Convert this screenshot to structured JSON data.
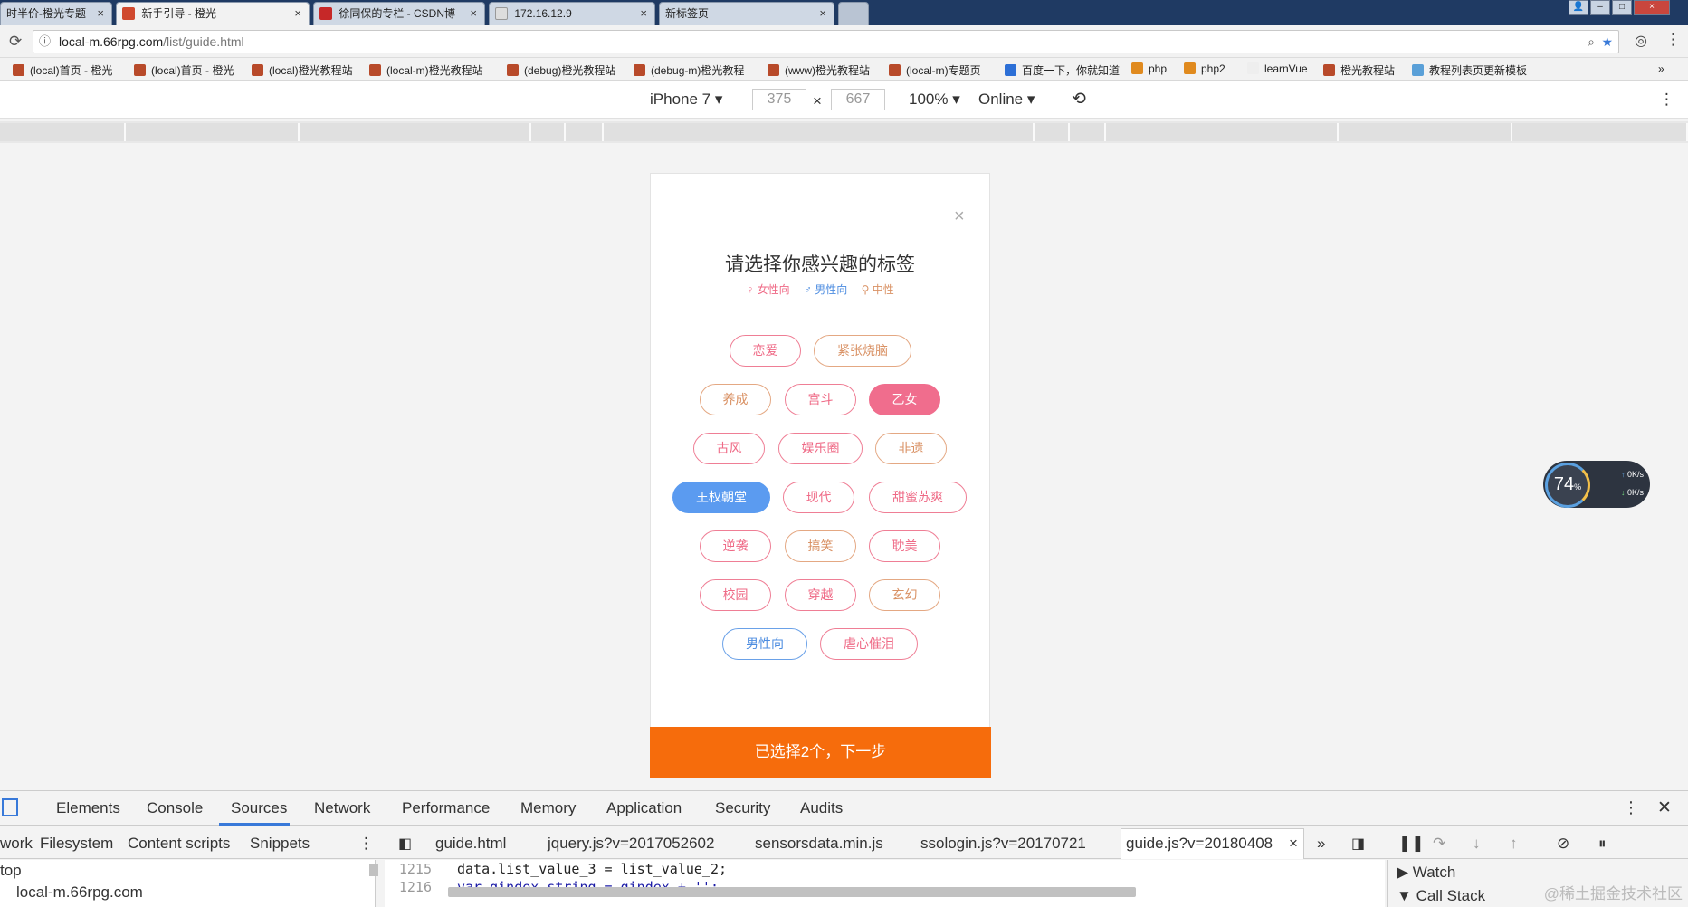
{
  "tabs": [
    {
      "label": "时半价-橙光专题"
    },
    {
      "label": "新手引导 - 橙光"
    },
    {
      "label": "徐同保的专栏 - CSDN博"
    },
    {
      "label": "172.16.12.9"
    },
    {
      "label": "新标签页"
    }
  ],
  "address": {
    "host": "local-m.66rpg.com",
    "path": "/list/guide.html"
  },
  "bookmarks": [
    "(local)首页 - 橙光",
    "(local)首页 - 橙光",
    "(local)橙光教程站",
    "(local-m)橙光教程站",
    "(debug)橙光教程站",
    "(debug-m)橙光教程",
    "(www)橙光教程站",
    "(local-m)专题页",
    "百度一下，你就知道",
    "php",
    "php2",
    "learnVue",
    "橙光教程站",
    "教程列表页更新模板"
  ],
  "device": {
    "name": "iPhone 7",
    "width": "375",
    "x": "×",
    "height": "667",
    "zoom": "100%",
    "network": "Online"
  },
  "modal": {
    "close": "×",
    "title": "请选择你感兴趣的标签",
    "legend": {
      "female": "♀ 女性向",
      "male": "♂ 男性向",
      "neutral": "⚲ 中性"
    },
    "tags": [
      "恋爱",
      "紧张烧脑",
      "养成",
      "宫斗",
      "乙女",
      "古风",
      "娱乐圈",
      "非遗",
      "王权朝堂",
      "现代",
      "甜蜜苏爽",
      "逆袭",
      "搞笑",
      "耽美",
      "校园",
      "穿越",
      "玄幻",
      "男性向",
      "虐心催泪"
    ],
    "next_button": "已选择2个，下一步"
  },
  "netwidget": {
    "percent": "74",
    "unit": "%",
    "up": "0K/s",
    "down": "0K/s"
  },
  "devtools": {
    "tabs": [
      "Elements",
      "Console",
      "Sources",
      "Network",
      "Performance",
      "Memory",
      "Application",
      "Security",
      "Audits"
    ],
    "nav_tabs": [
      "work",
      "Filesystem",
      "Content scripts",
      "Snippets"
    ],
    "files": [
      "guide.html",
      "jquery.js?v=2017052602",
      "sensorsdata.min.js",
      "ssologin.js?v=20170721",
      "guide.js?v=20180408"
    ],
    "tree": [
      "top",
      "local-m.66rpg.com"
    ],
    "code": [
      {
        "line": "1215",
        "text": "data.list_value_3 = list_value_2;"
      },
      {
        "line": "1216",
        "text": "var gindex_string = gindex + '';"
      }
    ],
    "debugger": [
      "Watch",
      "Call Stack"
    ]
  },
  "watermark": "@稀土掘金技术社区",
  "colors": {
    "accent": "#f66c0c",
    "female": "#ef6a86",
    "male": "#4c8ce0",
    "neutral": "#d99164"
  }
}
